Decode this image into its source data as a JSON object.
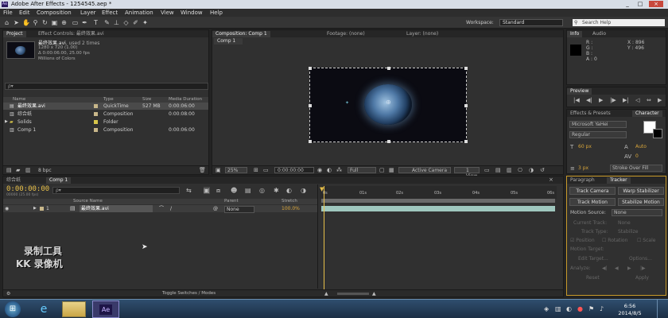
{
  "window": {
    "title": "Adobe After Effects - 1254545.aep *",
    "app_icon": "Ae",
    "controls": [
      "_",
      "□",
      "×"
    ]
  },
  "menu": [
    "File",
    "Edit",
    "Composition",
    "Layer",
    "Effect",
    "Animation",
    "View",
    "Window",
    "Help"
  ],
  "workspace": {
    "label": "Workspace:",
    "value": "Standard"
  },
  "search": {
    "placeholder": "Search Help"
  },
  "project": {
    "tab": "Project",
    "tab2": "Effect Controls: 最终效果.avi",
    "item_name": "最终效果.avi",
    "item_used": ", used 2 times",
    "item_info": [
      "1280 x 720 (1.00)",
      "Δ 0:00:06:00, 25.00 fps",
      "Millions of Colors"
    ],
    "search_placeholder": "ρ▾",
    "columns": [
      "Name",
      "Type",
      "Size",
      "Media Duration"
    ],
    "rows": [
      {
        "name": "最终效果.avi",
        "type": "QuickTime",
        "size": "527 MB",
        "dur": "0:00:06:00",
        "color": "#c8b78a",
        "selected": true
      },
      {
        "name": "综合纸",
        "type": "Composition",
        "size": "",
        "dur": "0:00:08:00",
        "color": "#c8b78a",
        "selected": false
      },
      {
        "name": "Solids",
        "type": "Folder",
        "size": "",
        "dur": "",
        "color": "#d8c64a",
        "selected": false
      },
      {
        "name": "Comp 1",
        "type": "Composition",
        "size": "",
        "dur": "0:00:06:00",
        "color": "#c8b78a",
        "selected": false
      }
    ],
    "bpc": "8 bpc"
  },
  "composition": {
    "tab": "Composition: Comp 1",
    "tab2": "Footage: (none)",
    "tab3": "Layer: (none)",
    "comp_tab": "Comp 1",
    "zoom": "25%",
    "time": "0:00:00:00",
    "quality": "Full",
    "camera": "Active Camera",
    "views": "1 View"
  },
  "info": {
    "tab": "Info",
    "tab2": "Audio",
    "r": "R :",
    "g": "G :",
    "b": "B :",
    "a": "A : 0",
    "x": "X : 896",
    "y": "Y : 496"
  },
  "preview": {
    "tab": "Preview",
    "controls": [
      "|◀",
      "◀|",
      "▶",
      "|▶",
      "▶|",
      "◁",
      "⇔"
    ]
  },
  "effects": {
    "tab": "Effects & Presets",
    "tab2": "Character"
  },
  "character": {
    "font": "Microsoft YaHei",
    "style": "Regular",
    "size": "60 px",
    "leading": "Auto",
    "tracking": "0",
    "stroke_px": "3 px",
    "stroke_over": "Stroke Over Fill"
  },
  "paragraph": {
    "tab": "Paragraph",
    "tab2": "Tracker"
  },
  "tracker": {
    "track_camera": "Track Camera",
    "warp_stabilizer": "Warp Stabilizer",
    "track_motion": "Track Motion",
    "stabilize_motion": "Stabilize Motion",
    "motion_source_label": "Motion Source:",
    "motion_source": "None",
    "current_track": "Current Track:",
    "current_track_val": "None",
    "track_type": "Track Type:",
    "track_type_val": "Stabilize",
    "position": "Position",
    "rotation": "Rotation",
    "scale": "Scale",
    "motion_target": "Motion Target:",
    "edit_target": "Edit Target...",
    "options": "Options...",
    "analyze": "Analyze:",
    "reset": "Reset",
    "apply": "Apply"
  },
  "timeline": {
    "tab1": "综合纸",
    "tab2": "Comp 1",
    "timecode": "0:00:00:00",
    "timecode_sub": "00000 (25.00 fps)",
    "search_placeholder": "ρ▾",
    "columns": {
      "source": "Source Name",
      "parent": "Parent",
      "stretch": "Stretch"
    },
    "layer": {
      "num": "1",
      "name": "最终效果.avi",
      "parent": "None",
      "stretch": "100.0%"
    },
    "ruler": [
      "0s",
      "01s",
      "02s",
      "03s",
      "04s",
      "05s",
      "06s"
    ],
    "toggle": "Toggle Switches / Modes"
  },
  "watermark": {
    "line1": "录制工具",
    "line2": "KK 录像机"
  },
  "taskbar": {
    "time": "6:56",
    "date": "2014/8/5",
    "ae": "Ae"
  }
}
